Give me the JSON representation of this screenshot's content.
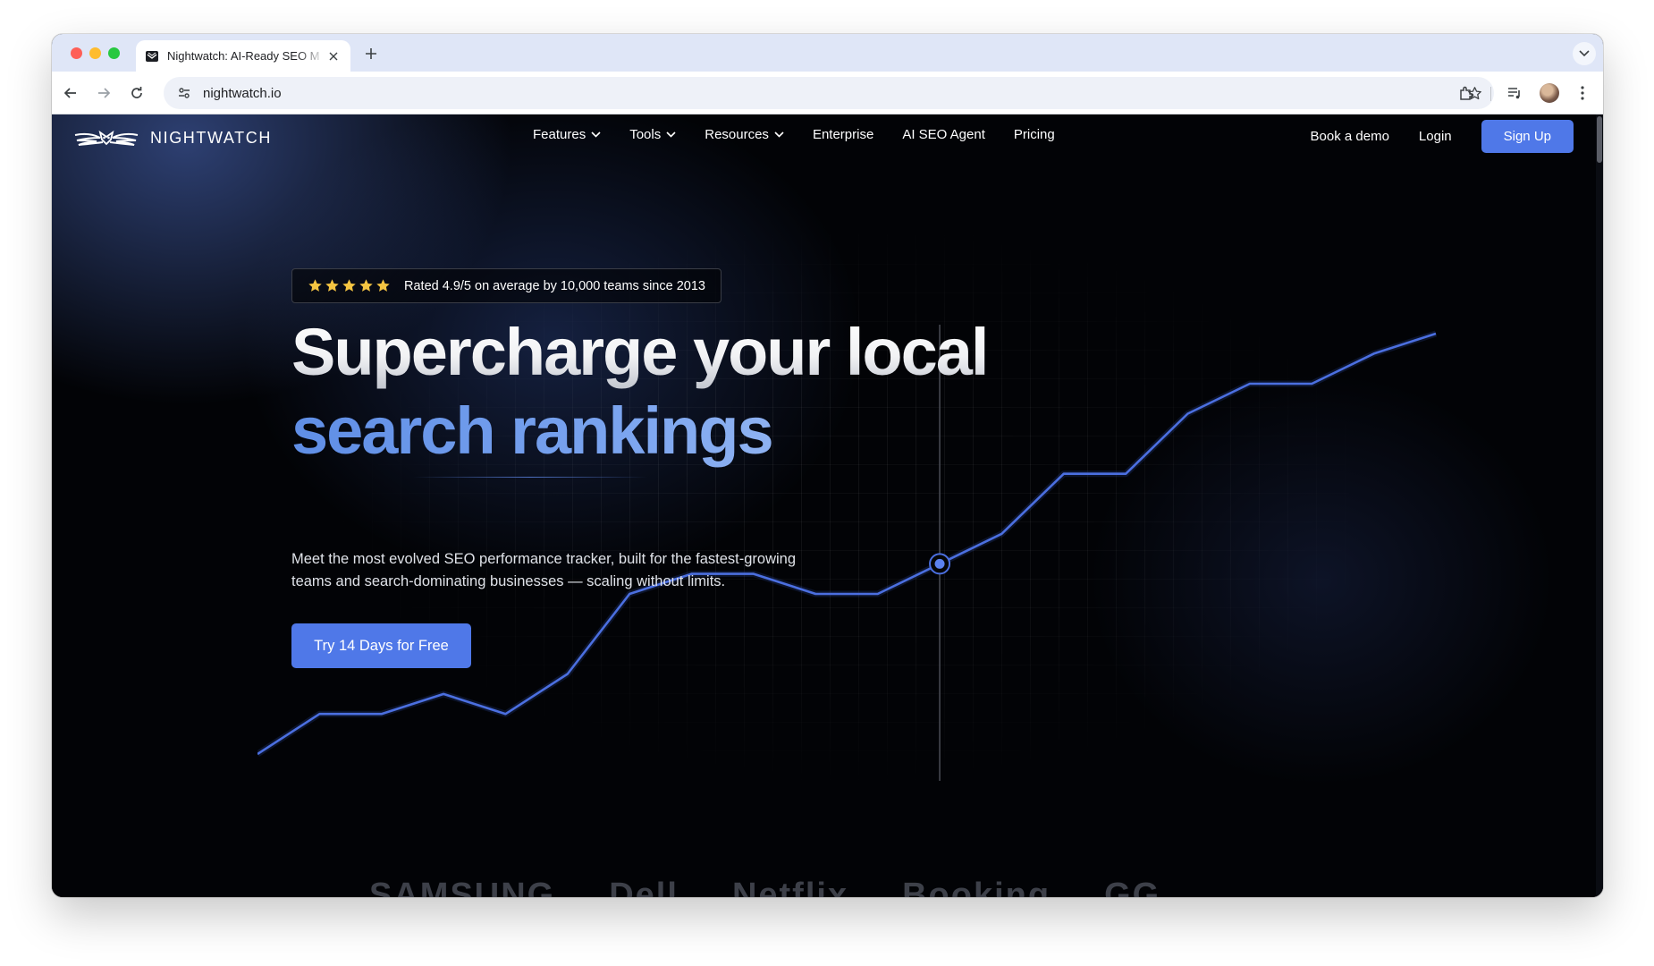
{
  "browser": {
    "tab_title": "Nightwatch: AI-Ready SEO M",
    "url": "nightwatch.io"
  },
  "nav": {
    "brand": "NIGHTWATCH",
    "items": [
      {
        "label": "Features",
        "dropdown": true
      },
      {
        "label": "Tools",
        "dropdown": true
      },
      {
        "label": "Resources",
        "dropdown": true
      },
      {
        "label": "Enterprise",
        "dropdown": false
      },
      {
        "label": "AI SEO Agent",
        "dropdown": false
      },
      {
        "label": "Pricing",
        "dropdown": false
      }
    ],
    "book_demo": "Book a demo",
    "login": "Login",
    "signup": "Sign Up"
  },
  "hero": {
    "stars": 5,
    "rating_text": "Rated 4.9/5 on average by 10,000 teams since 2013",
    "headline_line1": "Supercharge your local",
    "headline_line2": "search rankings",
    "subtitle": "Meet the most evolved SEO performance tracker, built for the fastest-growing teams and search-dominating businesses — scaling without limits.",
    "cta": "Try 14 Days for Free"
  },
  "client_logos": [
    "SAMSUNG",
    "Dell",
    "Netflix",
    "Booking",
    "GG"
  ],
  "colors": {
    "accent": "#4f78e8",
    "headline_gradient_start": "#5f8ee6",
    "headline_gradient_end": "#a9c5f5",
    "line": "#4b6fe0",
    "background": "#020306"
  },
  "icons": {
    "logo": "owl-wings-icon",
    "star": "star-icon",
    "dropdown": "chevron-down-icon"
  },
  "chart_data": {
    "type": "line",
    "title": "",
    "xlabel": "",
    "ylabel": "",
    "x": [
      0,
      1,
      2,
      3,
      4,
      5,
      6,
      7,
      8,
      9,
      10,
      11,
      12,
      13,
      14,
      15,
      16,
      17,
      18,
      19
    ],
    "series": [
      {
        "values": [
          0,
          2,
          2,
          3,
          2,
          4,
          8,
          9,
          9,
          8,
          8,
          9.5,
          11,
          14,
          14,
          17,
          18.5,
          18.5,
          20,
          21
        ]
      }
    ],
    "highlight_index": 11,
    "ylim": [
      0,
      21
    ]
  }
}
